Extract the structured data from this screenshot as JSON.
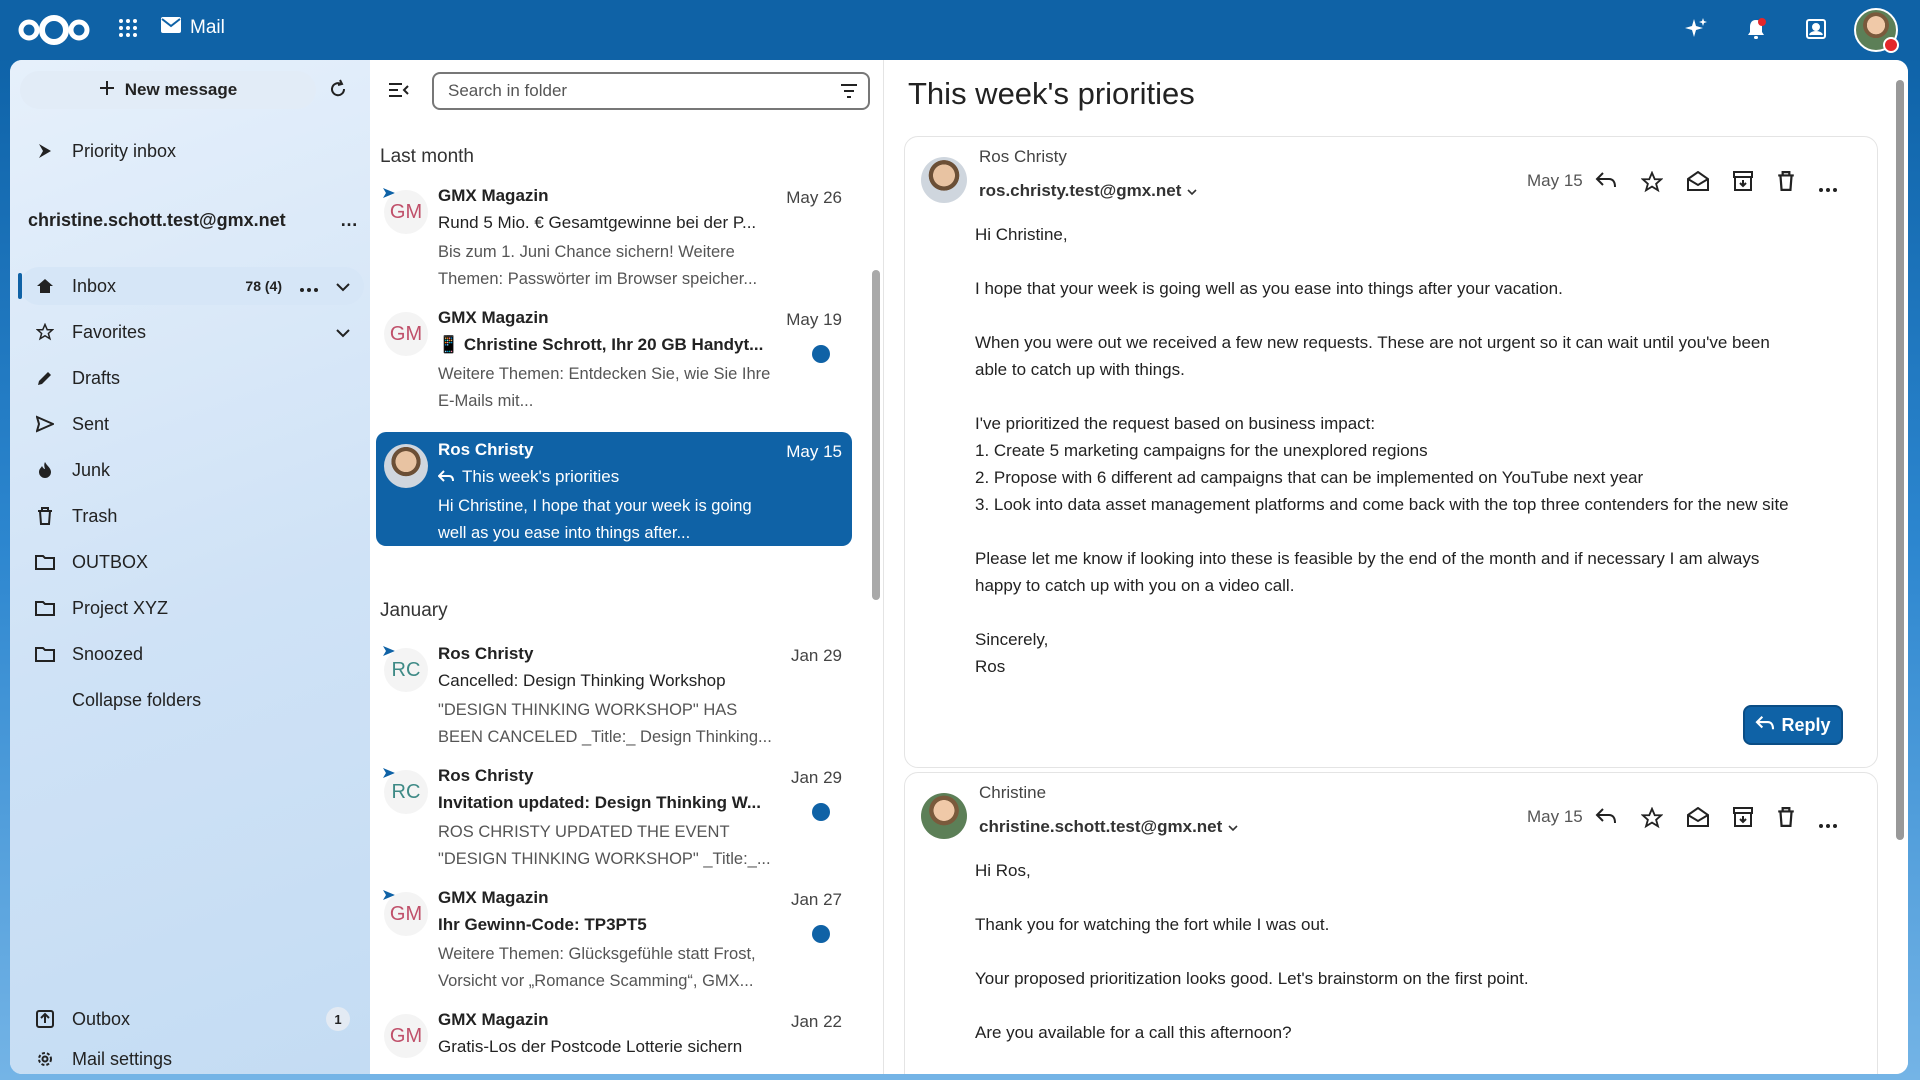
{
  "app": {
    "name": "Mail"
  },
  "sidebar": {
    "new_message": "New message",
    "priority_inbox": "Priority inbox",
    "account": "christine.schott.test@gmx.net",
    "account_more": "…",
    "inbox": {
      "label": "Inbox",
      "count": "78 (4)"
    },
    "folders": [
      "Favorites",
      "Drafts",
      "Sent",
      "Junk",
      "Trash",
      "OUTBOX",
      "Project XYZ",
      "Snoozed"
    ],
    "collapse": "Collapse folders",
    "outbox": {
      "label": "Outbox",
      "count": "1"
    },
    "settings": "Mail settings"
  },
  "list": {
    "search_placeholder": "Search in folder",
    "section1": "Last month",
    "section2": "January",
    "messages": [
      {
        "initials": "GM",
        "from": "GMX Magazin",
        "date": "May 26",
        "subject": "Rund 5 Mio. € Gesamtgewinne bei der P...",
        "preview": "Bis zum 1. Juni Chance sichern! Weitere Themen: Passwörter im Browser speicher..."
      },
      {
        "initials": "GM",
        "from": "GMX Magazin",
        "date": "May 19",
        "subject": "📱 Christine Schrott, Ihr 20 GB Handyt...",
        "preview": "Weitere Themen: Entdecken Sie, wie Sie Ihre E-Mails mit..."
      },
      {
        "initials": "",
        "from": "Ros Christy",
        "date": "May 15",
        "subject": "This week's priorities",
        "preview": "Hi Christine, I hope that your week is going well as you ease into things after..."
      },
      {
        "initials": "RC",
        "from": "Ros Christy",
        "date": "Jan 29",
        "subject": "Cancelled: Design Thinking Workshop",
        "preview": "\"DESIGN THINKING WORKSHOP\" HAS BEEN CANCELED _Title:_ Design Thinking..."
      },
      {
        "initials": "RC",
        "from": "Ros Christy",
        "date": "Jan 29",
        "subject": "Invitation updated: Design Thinking W...",
        "preview": "ROS CHRISTY UPDATED THE EVENT \"DESIGN THINKING WORKSHOP\" _Title:_..."
      },
      {
        "initials": "GM",
        "from": "GMX Magazin",
        "date": "Jan 27",
        "subject": "Ihr Gewinn-Code: TP3PT5",
        "preview": "Weitere Themen: Glücksgefühle statt Frost, Vorsicht vor „Romance Scamming“, GMX..."
      },
      {
        "initials": "GM",
        "from": "GMX Magazin",
        "date": "Jan 22",
        "subject": "Gratis-Los der Postcode Lotterie sichern",
        "preview": ""
      }
    ]
  },
  "reader": {
    "title": "This week's priorities",
    "msg1": {
      "name": "Ros Christy",
      "address": "ros.christy.test@gmx.net",
      "date": "May 15",
      "lines": [
        "Hi Christine,",
        "",
        "I hope that your week is going well as you ease into things after your vacation.",
        "",
        "When you were out we received a few new requests. These are not urgent so it can wait until you've been",
        "able to catch up with things.",
        "",
        "I've prioritized the request based on business impact:",
        "1. Create 5 marketing campaigns for the unexplored regions",
        "2. Propose with 6 different ad campaigns that can be implemented on YouTube next year",
        "3. Look into data asset management platforms and come back with the top three contenders for the new site",
        "",
        "Please let me know if looking into these is feasible by the end of the month and if necessary I am always",
        "happy to catch up with you on a video call.",
        "",
        "Sincerely,",
        "Ros"
      ],
      "reply": "Reply"
    },
    "msg2": {
      "name": "Christine",
      "address": "christine.schott.test@gmx.net",
      "date": "May 15",
      "lines": [
        "Hi Ros,",
        "",
        "Thank you for watching the fort while I was out.",
        "",
        "Your proposed prioritization looks good. Let's brainstorm on the first point.",
        "",
        "Are you available for a call this afternoon?"
      ]
    }
  },
  "colors": {
    "brand": "#0f62a6",
    "unread": "#0f62a6",
    "gm_text": "#c0506a",
    "rc_text": "#3e8a86"
  }
}
